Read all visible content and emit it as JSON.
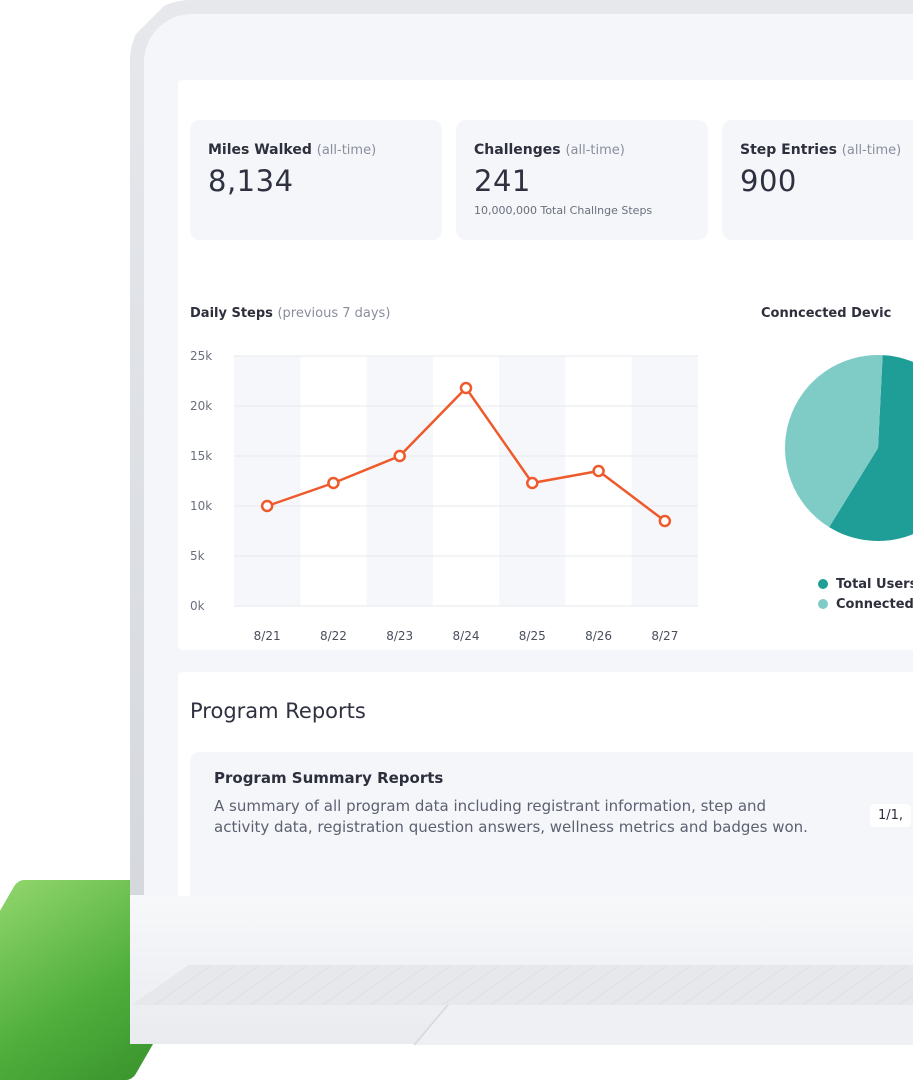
{
  "stats": [
    {
      "title": "Miles Walked",
      "qualifier": "(all-time)",
      "value": "8,134",
      "sub": ""
    },
    {
      "title": "Challenges",
      "qualifier": "(all-time)",
      "value": "241",
      "sub": "10,000,000 Total Challnge Steps"
    },
    {
      "title": "Step Entries",
      "qualifier": "(all-time)",
      "value": "900",
      "sub": ""
    }
  ],
  "daily_steps": {
    "title": "Daily Steps",
    "qualifier": "(previous 7 days)"
  },
  "devices": {
    "title": "Conncected Devic",
    "legend": [
      "Total Users",
      "Connected Dev"
    ]
  },
  "reports": {
    "heading": "Program Reports",
    "card_title": "Program Summary Reports",
    "card_desc": "A summary of all program data including registrant information, step and activity data, registration question answers, wellness metrics and badges won.",
    "date": "1/1,"
  },
  "colors": {
    "line": "#ee5a2b",
    "pie_dark": "#1f9e98",
    "pie_light": "#7fcbc6",
    "green": "#4fae3c"
  },
  "chart_data": [
    {
      "type": "line",
      "title": "Daily Steps (previous 7 days)",
      "categories": [
        "8/21",
        "8/22",
        "8/23",
        "8/24",
        "8/25",
        "8/26",
        "8/27"
      ],
      "series": [
        {
          "values": [
            10000,
            12300,
            15000,
            21800,
            12300,
            13500,
            8500
          ]
        }
      ],
      "y_ticks": [
        "0k",
        "5k",
        "10k",
        "15k",
        "20k",
        "25k"
      ],
      "ylim": [
        0,
        25000
      ],
      "grid": true
    },
    {
      "type": "pie",
      "title": "Conncected Devic",
      "labels": [
        "Total Users",
        "Connected Dev"
      ],
      "values": [
        58,
        42
      ],
      "legend": "bottom"
    }
  ]
}
